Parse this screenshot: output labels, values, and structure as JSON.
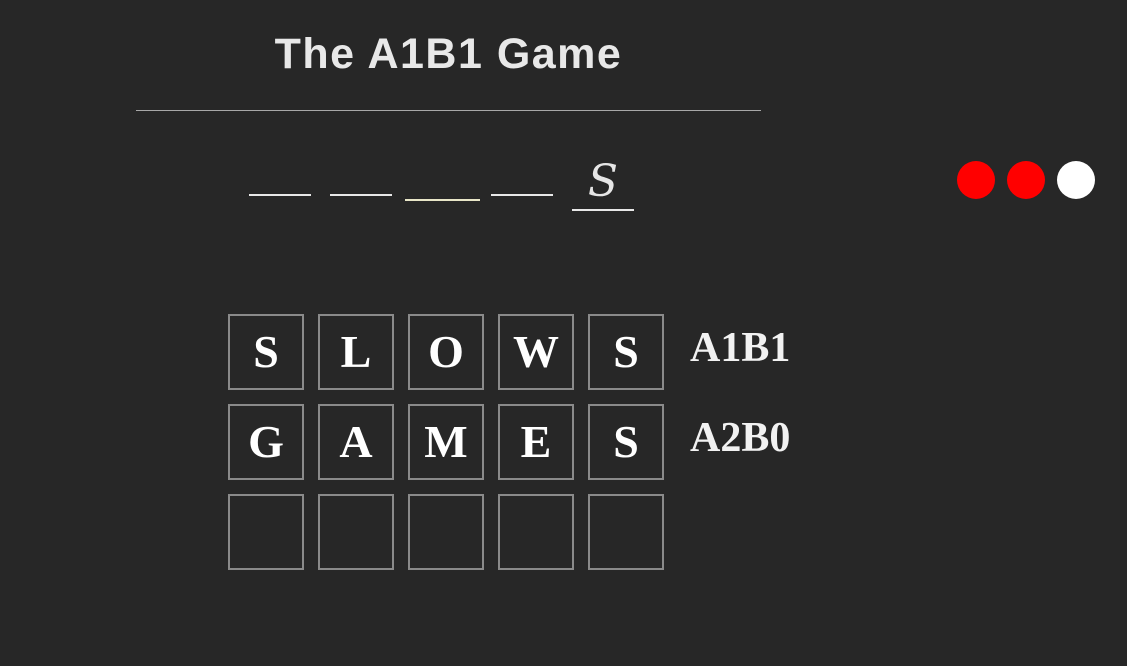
{
  "game": {
    "title": "The A1B1 Game"
  },
  "answer_slots": [
    {
      "letter": ""
    },
    {
      "letter": ""
    },
    {
      "letter": ""
    },
    {
      "letter": ""
    },
    {
      "letter": "S"
    }
  ],
  "lives": [
    {
      "state": "used",
      "color": "#ff0000"
    },
    {
      "state": "used",
      "color": "#ff0000"
    },
    {
      "state": "remaining",
      "color": "#ffffff"
    }
  ],
  "guesses": [
    {
      "letters": [
        "S",
        "L",
        "O",
        "W",
        "S"
      ],
      "result": "A1B1"
    },
    {
      "letters": [
        "G",
        "A",
        "M",
        "E",
        "S"
      ],
      "result": "A2B0"
    },
    {
      "letters": [
        "",
        "",
        "",
        "",
        ""
      ],
      "result": ""
    }
  ],
  "colors": {
    "background": "#272727",
    "tile_border": "#8a8a8a",
    "active_slot": "#e9e6c8"
  }
}
